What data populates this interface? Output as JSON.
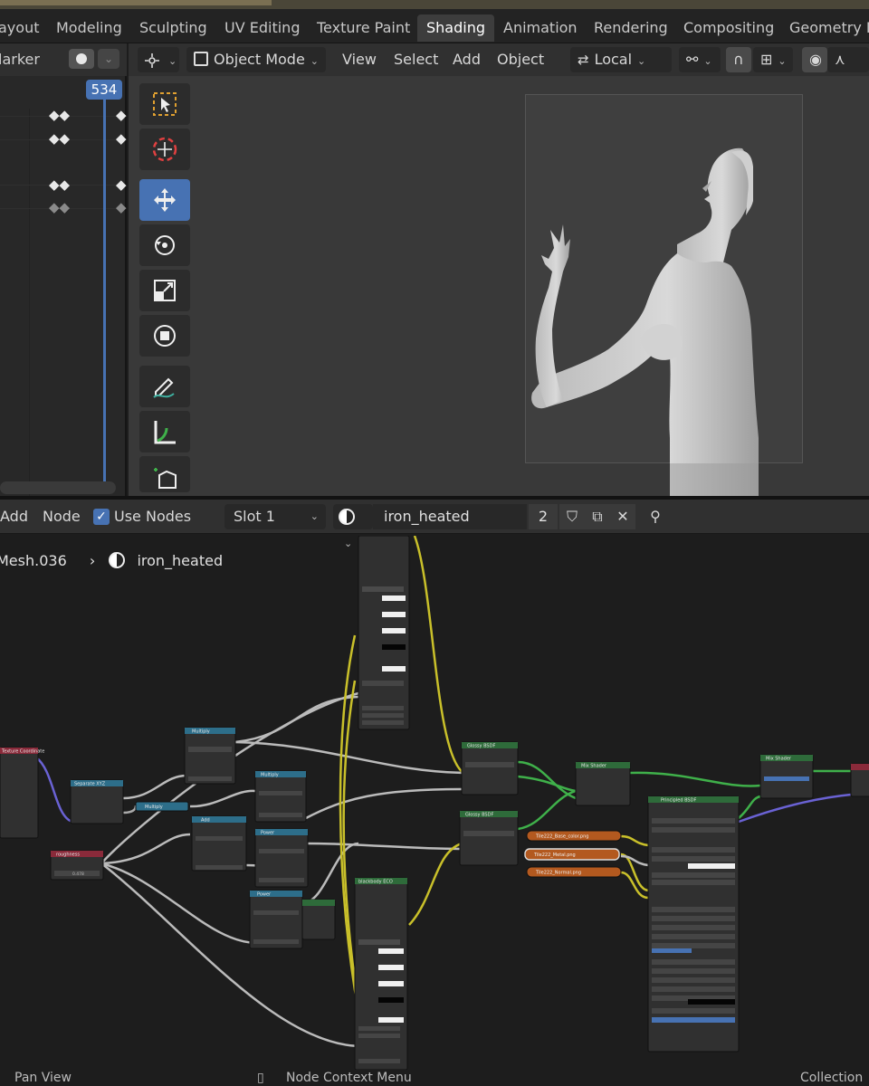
{
  "workspace_tabs": [
    {
      "label": "ayout"
    },
    {
      "label": "Modeling"
    },
    {
      "label": "Sculpting"
    },
    {
      "label": "UV Editing"
    },
    {
      "label": "Texture Paint"
    },
    {
      "label": "Shading",
      "active": true
    },
    {
      "label": "Animation"
    },
    {
      "label": "Rendering"
    },
    {
      "label": "Compositing"
    },
    {
      "label": "Geometry No"
    }
  ],
  "timeline": {
    "marker_label": "larker",
    "current_frame": "534"
  },
  "viewport": {
    "mode": "Object Mode",
    "menus": [
      "View",
      "Select",
      "Add",
      "Object"
    ],
    "orientation": "Local",
    "tools": [
      "select-box",
      "cursor",
      "move",
      "rotate",
      "scale",
      "transform",
      "annotate",
      "measure",
      "add-cube"
    ]
  },
  "node_editor": {
    "menus": {
      "add": "Add",
      "node": "Node"
    },
    "use_nodes_label": "Use Nodes",
    "use_nodes_checked": true,
    "slot": "Slot 1",
    "material_name": "iron_heated",
    "user_count": "2",
    "breadcrumb": {
      "object": "Mesh.036",
      "material": "iron_heated"
    },
    "nodes": {
      "texcoord": "Texture Coordinate",
      "separate": "Separate XYZ",
      "multiply_a": "Multiply",
      "multiply_b": "Multiply",
      "multiply_c": "Multiply",
      "add": "Add",
      "power_a": "Power",
      "power_b": "Power",
      "roughness": "roughness",
      "roughness_value": "0.478",
      "glossy_a": "Glossy BSDF",
      "glossy_b": "Glossy BSDF",
      "mix_a": "Mix Shader",
      "mix_b": "Mix Shader",
      "principled": "Principled BSDF",
      "blackbody": "blackbody ECO",
      "images": [
        "Tile222_Base_color.png",
        "Tile222_Metal.png",
        "Tile222_Normal.png"
      ]
    }
  },
  "status_bar": {
    "left": "Pan View",
    "center": "Node Context Menu",
    "right": "Collection"
  },
  "colors": {
    "accent_blue": "#4772b3",
    "node_header_green": "#2e6b3a",
    "node_header_teal": "#2d6e8a",
    "node_header_red": "#8a2a3a",
    "image_orange": "#b3591f",
    "wire_yellow": "#c9c02a",
    "wire_green": "#3fb04a",
    "wire_purple": "#6a62d4"
  }
}
